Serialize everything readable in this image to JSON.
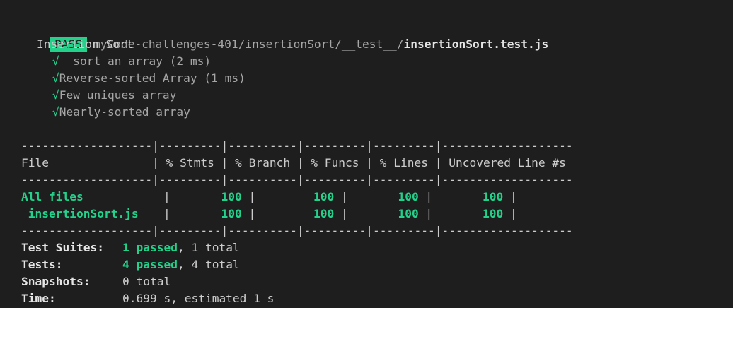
{
  "header": {
    "status_badge": "PASS",
    "path_dir": "myCode-challenges-401/insertionSort/__test__/",
    "path_file": "insertionSort.test.js"
  },
  "suite": {
    "name": "Insertion Sort",
    "tests": [
      {
        "check": "√",
        "name": " sort an array (2 ms)"
      },
      {
        "check": "√",
        "name": "Reverse-sorted Array (1 ms)"
      },
      {
        "check": "√",
        "name": "Few uniques array"
      },
      {
        "check": "√",
        "name": "Nearly-sorted array"
      }
    ]
  },
  "coverage": {
    "divider": "-------------------|---------|----------|---------|---------|-------------------",
    "header_line": "File               | % Stmts | % Branch | % Funcs | % Lines | Uncovered Line #s ",
    "rows": [
      {
        "file": "All files",
        "stmts": "100",
        "branch": "100",
        "funcs": "100",
        "lines": "100",
        "uncovered": ""
      },
      {
        "file": " insertionSort.js",
        "stmts": "100",
        "branch": "100",
        "funcs": "100",
        "lines": "100",
        "uncovered": ""
      }
    ]
  },
  "summary": {
    "suites_label": "Test Suites:",
    "suites_passed": "1 passed",
    "suites_total": ", 1 total",
    "tests_label": "Tests:",
    "tests_passed": "4 passed",
    "tests_total": ", 4 total",
    "snapshots_label": "Snapshots:",
    "snapshots_value": "0 total",
    "time_label": "Time:",
    "time_value": "0.699 s, estimated 1 s"
  }
}
